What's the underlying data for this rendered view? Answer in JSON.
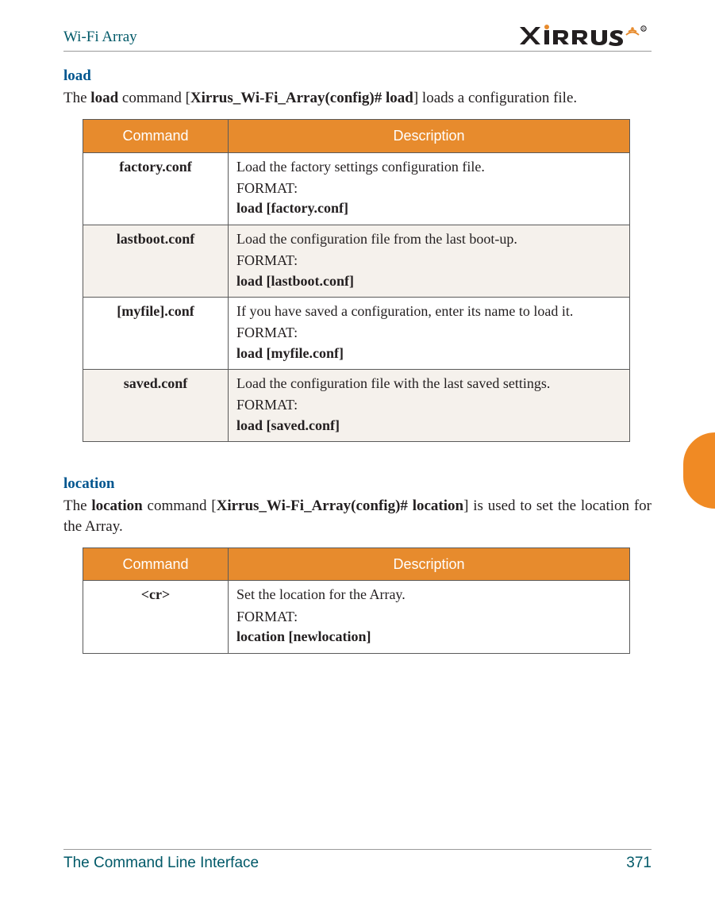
{
  "header": {
    "product": "Wi-Fi Array",
    "brand": "XIRRUS"
  },
  "sections": [
    {
      "title": "load",
      "intro_parts": [
        "The ",
        "load",
        " command [",
        "Xirrus_Wi-Fi_Array(config)# load",
        "] loads a configuration file."
      ],
      "table": {
        "headers": {
          "cmd": "Command",
          "desc": "Description"
        },
        "rows": [
          {
            "cmd": "factory.conf",
            "desc": "Load the factory settings configuration file.",
            "format_label": "FORMAT:",
            "format_cmd": "load [factory.conf]"
          },
          {
            "cmd": "lastboot.conf",
            "desc": "Load the configuration file from the last boot-up.",
            "format_label": "FORMAT:",
            "format_cmd": "load [lastboot.conf]"
          },
          {
            "cmd": "[myfile].conf",
            "desc": "If you have saved a configuration, enter its name to load it.",
            "format_label": "FORMAT:",
            "format_cmd": "load [myfile.conf]"
          },
          {
            "cmd": "saved.conf",
            "desc": "Load the configuration file with the last saved settings.",
            "format_label": "FORMAT:",
            "format_cmd": "load [saved.conf]"
          }
        ]
      }
    },
    {
      "title": "location",
      "intro_parts": [
        "The ",
        "location",
        " command [",
        "Xirrus_Wi-Fi_Array(config)# location",
        "] is used to set the location for the Array."
      ],
      "table": {
        "headers": {
          "cmd": "Command",
          "desc": "Description"
        },
        "rows": [
          {
            "cmd": "<cr>",
            "desc": "Set the location for the Array.",
            "format_label": "FORMAT:",
            "format_cmd": "location [newlocation]"
          }
        ]
      }
    }
  ],
  "footer": {
    "title": "The Command Line Interface",
    "page": "371"
  }
}
